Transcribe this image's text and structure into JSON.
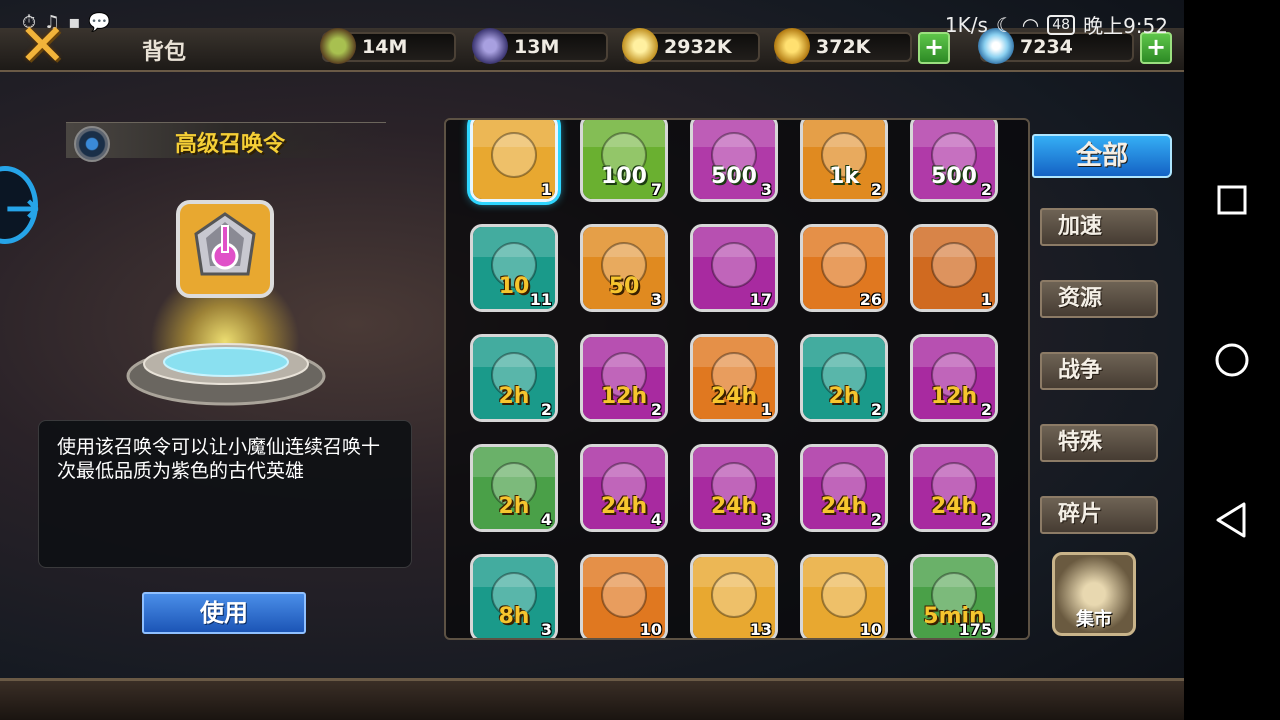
{
  "status_bar": {
    "net_speed": "1K/s",
    "battery": "48",
    "time": "晚上9:52"
  },
  "header": {
    "close_icon": "close-x-icon",
    "title": "背包"
  },
  "resources": [
    {
      "name": "wood",
      "value": "14M",
      "color": "#7a9a3a"
    },
    {
      "name": "stone",
      "value": "13M",
      "color": "#6a62a8"
    },
    {
      "name": "gold-ore",
      "value": "2932K",
      "color": "#e8c048"
    },
    {
      "name": "gold",
      "value": "372K",
      "color": "#e0a820"
    }
  ],
  "gems": {
    "value": "7234"
  },
  "selected_item": {
    "title": "高级召唤令",
    "description": "使用该召唤令可以让小魔仙连续召唤十次最低品质为紫色的古代英雄",
    "use_label": "使用"
  },
  "grid_items": [
    {
      "id": "advanced-summon-token",
      "bg": "#e8a830",
      "badge": "",
      "count": "1",
      "selected": true
    },
    {
      "id": "exp-potion-100",
      "bg": "#6ab030",
      "badge": "100",
      "count": "7"
    },
    {
      "id": "exp-potion-500",
      "bg": "#b03aa8",
      "badge": "500",
      "count": "3"
    },
    {
      "id": "exp-potion-1k",
      "bg": "#e08a20",
      "badge": "1k",
      "count": "2"
    },
    {
      "id": "wrench-500",
      "bg": "#b03aa8",
      "badge": "500",
      "count": "2"
    },
    {
      "id": "lightning-chest-10",
      "bg": "#1a9a8a",
      "badge": "10",
      "count": "11"
    },
    {
      "id": "lightning-chest-50",
      "bg": "#e08a20",
      "badge": "50",
      "count": "3"
    },
    {
      "id": "purple-wing-boots",
      "bg": "#a82aa0",
      "badge": "",
      "count": "17"
    },
    {
      "id": "orange-wing-boots",
      "bg": "#e07820",
      "badge": "",
      "count": "26"
    },
    {
      "id": "scroll",
      "bg": "#d06a20",
      "badge": "",
      "count": "1"
    },
    {
      "id": "build-speedup-2h",
      "bg": "#1a9a8a",
      "badge": "2h",
      "count": "2"
    },
    {
      "id": "build-speedup-12h",
      "bg": "#a82aa0",
      "badge": "12h",
      "count": "2"
    },
    {
      "id": "build-speedup-24h",
      "bg": "#e07820",
      "badge": "24h",
      "count": "1"
    },
    {
      "id": "shield-2h",
      "bg": "#1a9a8a",
      "badge": "2h",
      "count": "2"
    },
    {
      "id": "shield-12h",
      "bg": "#a82aa0",
      "badge": "12h",
      "count": "2"
    },
    {
      "id": "research-2h",
      "bg": "#4aa048",
      "badge": "2h",
      "count": "4"
    },
    {
      "id": "wood-boost-24h",
      "bg": "#a82aa0",
      "badge": "24h",
      "count": "4"
    },
    {
      "id": "stone-boost-24h",
      "bg": "#a82aa0",
      "badge": "24h",
      "count": "3"
    },
    {
      "id": "cheese-boost-24h",
      "bg": "#a82aa0",
      "badge": "24h",
      "count": "2"
    },
    {
      "id": "gold-boost-24h",
      "bg": "#a82aa0",
      "badge": "24h",
      "count": "2"
    },
    {
      "id": "pickaxe-8h",
      "bg": "#1a9a8a",
      "badge": "8h",
      "count": "3"
    },
    {
      "id": "gramophone",
      "bg": "#e07820",
      "badge": "",
      "count": "10"
    },
    {
      "id": "refresh-card-blue",
      "bg": "#e8a830",
      "badge": "",
      "count": "13"
    },
    {
      "id": "refresh-card-red",
      "bg": "#e8a830",
      "badge": "",
      "count": "10"
    },
    {
      "id": "speedup-5min",
      "bg": "#4aa048",
      "badge": "5min",
      "count": "175"
    }
  ],
  "tabs": {
    "all": "全部",
    "speedup": "加速",
    "resource": "资源",
    "war": "战争",
    "special": "特殊",
    "fragment": "碎片"
  },
  "market": {
    "label": "集市"
  }
}
